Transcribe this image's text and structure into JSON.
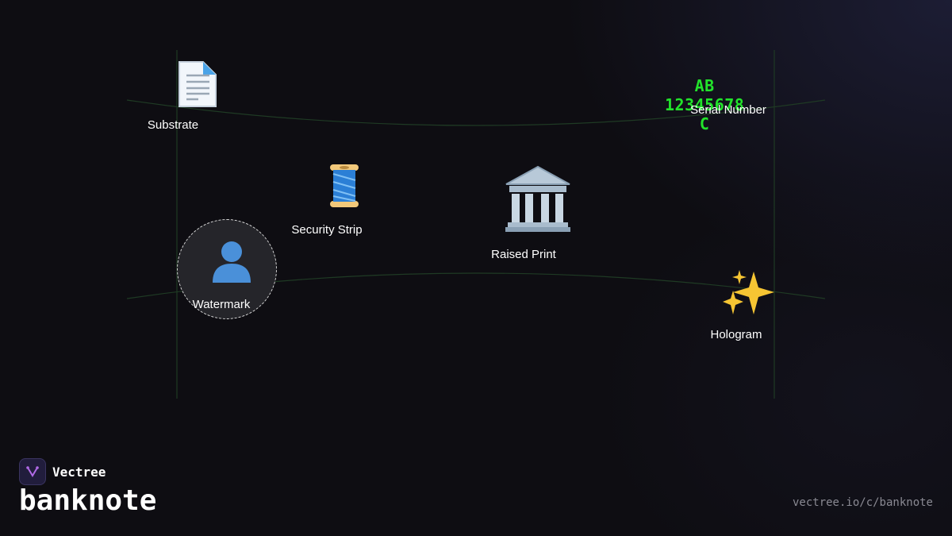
{
  "diagram": {
    "features": {
      "substrate": {
        "label": "Substrate",
        "icon": "document-icon"
      },
      "serial_number": {
        "label": "Serial Number",
        "value": "AB 12345678 C"
      },
      "security_strip": {
        "label": "Security Strip",
        "icon": "spool-of-thread-icon"
      },
      "raised_print": {
        "label": "Raised Print",
        "icon": "classical-building-icon"
      },
      "watermark": {
        "label": "Watermark",
        "icon": "person-silhouette-icon"
      },
      "hologram": {
        "label": "Hologram",
        "icon": "sparkles-icon"
      }
    },
    "colors": {
      "background": "#0e0d12",
      "serial": "#22e32b",
      "outline": "#1f3a24",
      "url": "#8a8a93"
    }
  },
  "footer": {
    "brand": "Vectree",
    "title": "banknote",
    "url": "vectree.io/c/banknote"
  }
}
